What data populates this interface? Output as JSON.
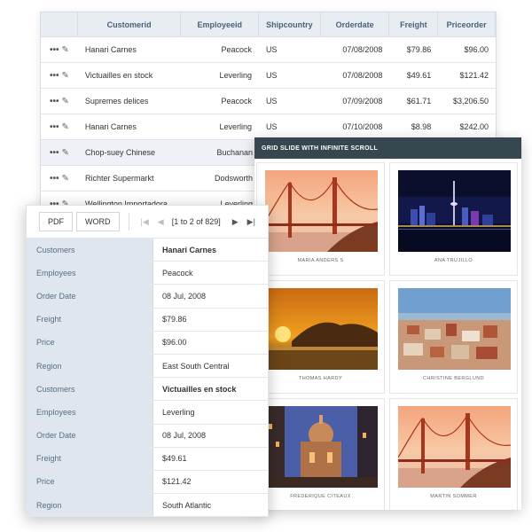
{
  "grid": {
    "columns": [
      "Customerid",
      "Employeeid",
      "Shipcountry",
      "Orderdate",
      "Freight",
      "Priceorder"
    ],
    "rows": [
      [
        "Hanari Carnes",
        "Peacock",
        "US",
        "07/08/2008",
        "$79.86",
        "$96.00"
      ],
      [
        "Victuailles en stock",
        "Leverling",
        "US",
        "07/08/2008",
        "$49.61",
        "$121.42"
      ],
      [
        "Supremes delices",
        "Peacock",
        "US",
        "07/09/2008",
        "$61.71",
        "$3,206.50"
      ],
      [
        "Hanari Carnes",
        "Leverling",
        "US",
        "07/10/2008",
        "$8.98",
        "$242.00"
      ],
      [
        "Chop-suey Chinese",
        "Buchanan",
        "",
        "",
        "",
        ""
      ],
      [
        "Richter Supermarkt",
        "Dodsworth",
        "",
        "",
        "",
        ""
      ],
      [
        "Wellington Importadora",
        "Leverling",
        "",
        "",
        "",
        ""
      ]
    ],
    "action_icons": {
      "more": "ellipsis-icon",
      "edit": "pencil-icon"
    }
  },
  "gallery": {
    "title": "GRID SLIDE WITH INFINITE SCROLL",
    "tiles": [
      {
        "caption": "MARIA ANDERS S",
        "photo": "golden-gate-bridge"
      },
      {
        "caption": "ANA TRUJILLO",
        "photo": "city-skyline-night"
      },
      {
        "caption": "THOMAS HARDY",
        "photo": "sunset-beach"
      },
      {
        "caption": "CHRISTINE BERGLUND",
        "photo": "old-city-rooftops"
      },
      {
        "caption": "FREDERIQUE CITEAUX",
        "photo": "domed-building-night"
      },
      {
        "caption": "MARTIN SOMMER",
        "photo": "golden-gate-bridge"
      }
    ]
  },
  "form": {
    "toolbar": {
      "pdf_label": "PDF",
      "word_label": "WORD",
      "page_info": "[1 to 2 of 829]",
      "icons": [
        "first-page-icon",
        "prev-page-icon",
        "next-page-icon",
        "last-page-icon"
      ]
    },
    "records": [
      {
        "fields": [
          {
            "label": "Customers",
            "value": "Hanari Carnes"
          },
          {
            "label": "Employees",
            "value": "Peacock"
          },
          {
            "label": "Order Date",
            "value": "08 Jul, 2008"
          },
          {
            "label": "Freight",
            "value": "$79.86"
          },
          {
            "label": "Price",
            "value": "$96.00"
          },
          {
            "label": "Region",
            "value": "East South Central"
          }
        ]
      },
      {
        "fields": [
          {
            "label": "Customers",
            "value": "Victuailles en stock"
          },
          {
            "label": "Employees",
            "value": "Leverling"
          },
          {
            "label": "Order Date",
            "value": "08 Jul, 2008"
          },
          {
            "label": "Freight",
            "value": "$49.61"
          },
          {
            "label": "Price",
            "value": "$121.42"
          },
          {
            "label": "Region",
            "value": "South Atlantic"
          }
        ]
      }
    ]
  }
}
